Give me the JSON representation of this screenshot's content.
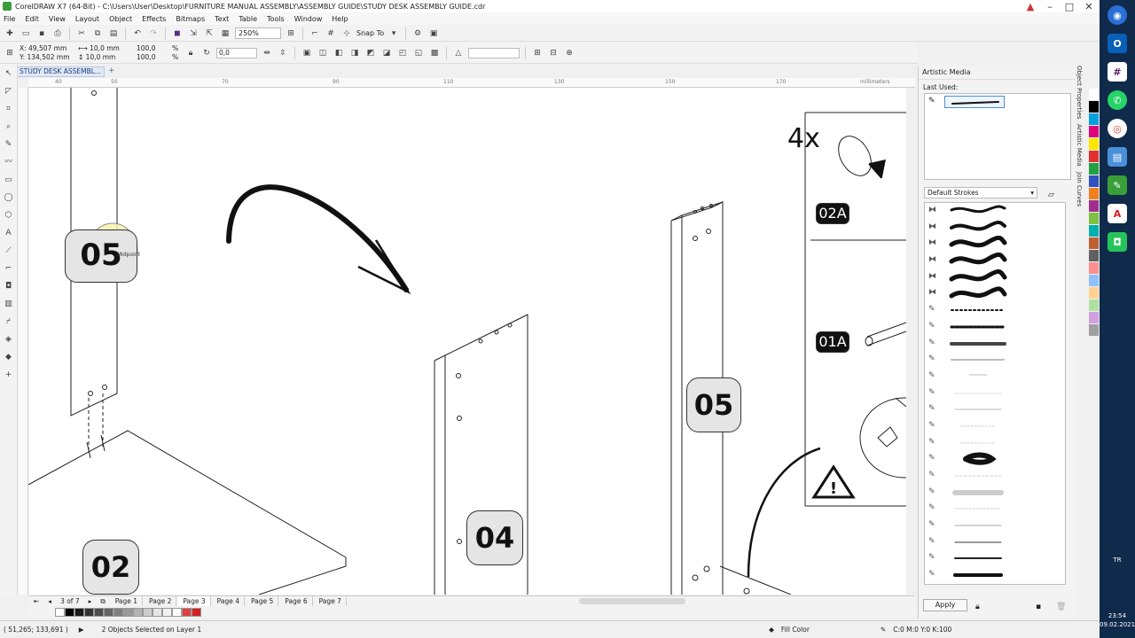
{
  "window": {
    "title": "CorelDRAW X7 (64-Bit) - C:\\Users\\User\\Desktop\\FURNITURE MANUAL ASSEMBLY\\ASSEMBLY GUIDE\\STUDY DESK ASSEMBLY GUIDE.cdr",
    "minimize": "–",
    "maximize": "□",
    "close": "✕"
  },
  "menu": [
    "File",
    "Edit",
    "View",
    "Layout",
    "Object",
    "Effects",
    "Bitmaps",
    "Text",
    "Table",
    "Tools",
    "Window",
    "Help"
  ],
  "toolbar": {
    "zoom": "250%",
    "snap_to": "Snap To"
  },
  "property_bar": {
    "x": "X: 49,507 mm",
    "y": "Y: 134,502 mm",
    "w": "10,0 mm",
    "h": "10,0 mm",
    "scale_w": "100,0",
    "scale_h": "100,0",
    "percent": "%",
    "angle": "0,0"
  },
  "document_tab": "STUDY DESK ASSEMBL...",
  "ruler": {
    "units": "millimeters",
    "h_labels": [
      "40",
      "50",
      "60",
      "70",
      "80",
      "90",
      "100",
      "110",
      "120",
      "130",
      "140",
      "150",
      "160",
      "170"
    ]
  },
  "canvas": {
    "badges": [
      "05",
      "05",
      "04",
      "02",
      "02A",
      "01A"
    ],
    "hardware_count": "4x",
    "midpoint_label": "Midpoint"
  },
  "pages": {
    "count": "3 of 7",
    "tabs": [
      "Page 1",
      "Page 2",
      "Page 3",
      "Page 4",
      "Page 5",
      "Page 6",
      "Page 7"
    ],
    "active_index": 2
  },
  "status": {
    "cursor": "( 51,265; 133,691 )",
    "selection": "2 Objects Selected on Layer 1",
    "fill": "Fill Color",
    "outline": "C:0 M:0 Y:0 K:100"
  },
  "docker": {
    "title": "Artistic Media",
    "last_used": "Last Used:",
    "category": "Default Strokes",
    "apply": "Apply",
    "side_tabs": [
      "Object Properties",
      "Artistic Media",
      "Join Curves"
    ]
  },
  "palette_colors": [
    "#ffffff",
    "#000000",
    "#1a1a1a",
    "#333333",
    "#4d4d4d",
    "#666666",
    "#808080",
    "#999999",
    "#b3b3b3",
    "#cccccc",
    "#e6e6e6",
    "#f2f2f2",
    "#ffffff",
    "#e04040",
    "#d62020"
  ],
  "strip_colors": [
    "#ffffff",
    "#000000",
    "#00a0e0",
    "#e0007a",
    "#ffe600",
    "#e03030",
    "#20a040",
    "#3050c0",
    "#f08020",
    "#a03090",
    "#80c040",
    "#00b0b0",
    "#c06030",
    "#606060",
    "#ff9090",
    "#90c0ff",
    "#ffd090",
    "#b0e0a0",
    "#d0a0e0",
    "#a0a0a0"
  ],
  "taskbar": {
    "lang": "TR",
    "time": "23:54",
    "date": "09.02.2021"
  },
  "colors": {
    "accent": "#4a8fd6",
    "highlight": "#f5e642",
    "taskbar": "#0f2a4a"
  }
}
